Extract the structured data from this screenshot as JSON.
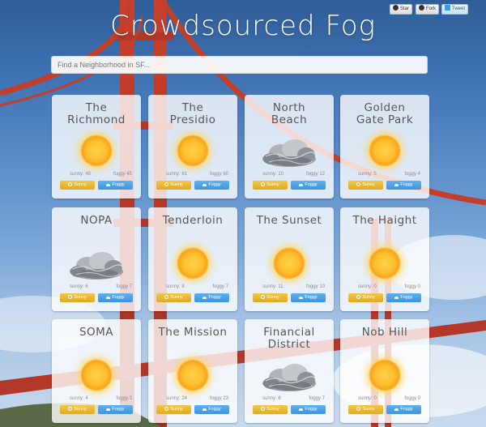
{
  "title": "Crowdsourced Fog",
  "github": {
    "star": "Star",
    "fork": "Fork",
    "tweet": "Tweet"
  },
  "search": {
    "placeholder": "Find a Neighborhood in SF..."
  },
  "labels": {
    "sunny_button": "Sunny",
    "foggy_button": "Foggy"
  },
  "colors": {
    "sunny": "#dfaa23",
    "foggy": "#3d93de"
  },
  "neighborhoods": [
    {
      "name": "The\nRichmond",
      "weather": "sunny-icon",
      "sunny": "sunny: 48",
      "foggy": "foggy 45"
    },
    {
      "name": "The\nPresidio",
      "weather": "sunny-icon",
      "sunny": "sunny: 61",
      "foggy": "foggy 60"
    },
    {
      "name": "North\nBeach",
      "weather": "fog-cloud-icon",
      "sunny": "sunny: 10",
      "foggy": "foggy 12"
    },
    {
      "name": "Golden\nGate Park",
      "weather": "sunny-icon",
      "sunny": "sunny: 5",
      "foggy": "foggy 4"
    },
    {
      "name": "NOPA",
      "weather": "fog-cloud-icon",
      "sunny": "sunny: 6",
      "foggy": "foggy 7"
    },
    {
      "name": "Tenderloin",
      "weather": "sunny-icon",
      "sunny": "sunny: 8",
      "foggy": "foggy 7"
    },
    {
      "name": "The Sunset",
      "weather": "sunny-icon",
      "sunny": "sunny: 11",
      "foggy": "foggy 10"
    },
    {
      "name": "The Haight",
      "weather": "sunny-icon",
      "sunny": "sunny: 0",
      "foggy": "foggy 0"
    },
    {
      "name": "SOMA",
      "weather": "sunny-icon",
      "sunny": "sunny: 4",
      "foggy": "foggy 3"
    },
    {
      "name": "The Mission",
      "weather": "sunny-icon",
      "sunny": "sunny: 24",
      "foggy": "foggy 23"
    },
    {
      "name": "Financial\nDistrict",
      "weather": "fog-cloud-icon",
      "sunny": "sunny: 8",
      "foggy": "foggy 7"
    },
    {
      "name": "Nob Hill",
      "weather": "sunny-icon",
      "sunny": "sunny: 0",
      "foggy": "foggy 0"
    }
  ]
}
